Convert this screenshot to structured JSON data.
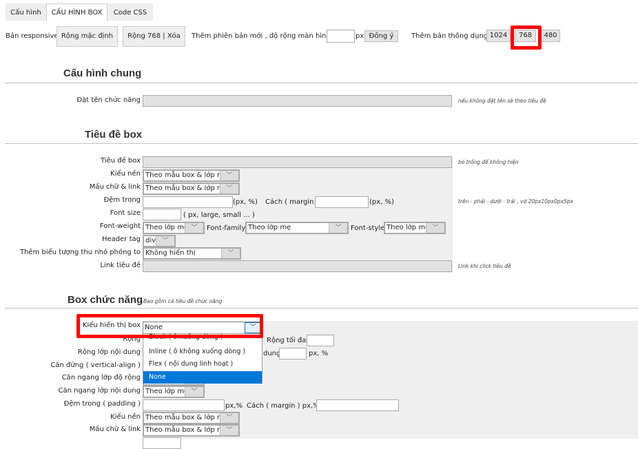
{
  "tabs": [
    {
      "label": "Cấu hình"
    },
    {
      "label": "CẤU HÌNH BOX",
      "active": true
    },
    {
      "label": "Code CSS"
    }
  ],
  "responsive": {
    "label": "Bản responsive",
    "default_btn": "Rộng mặc định",
    "w768_btn": "Rộng 768 | Xóa",
    "new_label": "Thêm phiên bản mới , độ rộng màn hình",
    "width_value": "",
    "unit": "px",
    "agree_btn": "Đồng ý",
    "common_label": "Thêm bản thông dụng",
    "presets": [
      "1024",
      "768",
      "480"
    ]
  },
  "highlight_color": "#ff0000",
  "general": {
    "heading": "Cấu hình chung",
    "name_label": "Đặt tên chức năng",
    "name_value": "",
    "name_hint": "nếu không đặt tên sẽ theo tiêu đề"
  },
  "title_box": {
    "heading": "Tiêu đề box",
    "title_label": "Tiêu đề box",
    "title_hint": "bỏ trống để không hiện",
    "bg_label": "Kiểu nền",
    "bg_value": "Theo mẫu box & lớp mẹ",
    "color_label": "Mầu chữ & link",
    "color_value": "Theo mẫu box & lớp mẹ",
    "padding_label": "Đệm trong",
    "padding_unit": "(px, %)",
    "margin_label": "Cách ( margin )",
    "margin_unit": "(px, %)",
    "padding_hint": "trên - phải - dưới - trái , vd 20px10px0px5px",
    "fontsize_label": "Font size",
    "fontsize_unit": "( px, large, small ... )",
    "fontweight_label": "Font-weight",
    "fontweight_value": "Theo lớp mẹ",
    "fontfamily_label": "Font-family",
    "fontfamily_value": "Theo lớp mẹ",
    "fontstyle_label": "Font-style",
    "fontstyle_value": "Theo lớp mẹ",
    "headertag_label": "Header tag",
    "headertag_value": "div",
    "icon_label": "Thêm biểu tượng thu nhỏ phóng to",
    "icon_value": "Không hiển thị",
    "link_label": "Link tiêu đề",
    "link_hint": "Link khi click tiêu đề"
  },
  "func_box": {
    "heading": "Box chức năng",
    "heading_hint": "Bao gồm cả tiêu đề chức năng",
    "display_label": "Kiểu hiển thị box",
    "display_value": "None",
    "display_options": [
      "Block ( ô xuống dòng )",
      "Inline ( ô không xuống dòng )",
      "Flex ( nội dung linh hoạt )",
      "None"
    ],
    "width_label": "Rộng",
    "maxwidth_label": "Rộng tối đa",
    "content_width_label": "Rộng lớp nội dung",
    "content_partial": "dung",
    "content_unit": "px, %",
    "valign_label": "Căn đứng ( vertical-align )",
    "halign_width_label": "Căn ngang lớp độ rộng",
    "halign_content_label": "Căn ngang lớp nội dung",
    "halign_content_value": "Theo lớp mẹ",
    "padding_label": "Đệm trong ( padding )",
    "padding_unit": "px,%",
    "margin_label": "Cách ( margin ) px,%",
    "bg_label": "Kiểu nền",
    "bg_value": "Theo mẫu box & lớp mẹ",
    "color_label": "Mầu chữ & link",
    "color_value": "Theo mẫu box & lớp mẹ"
  }
}
